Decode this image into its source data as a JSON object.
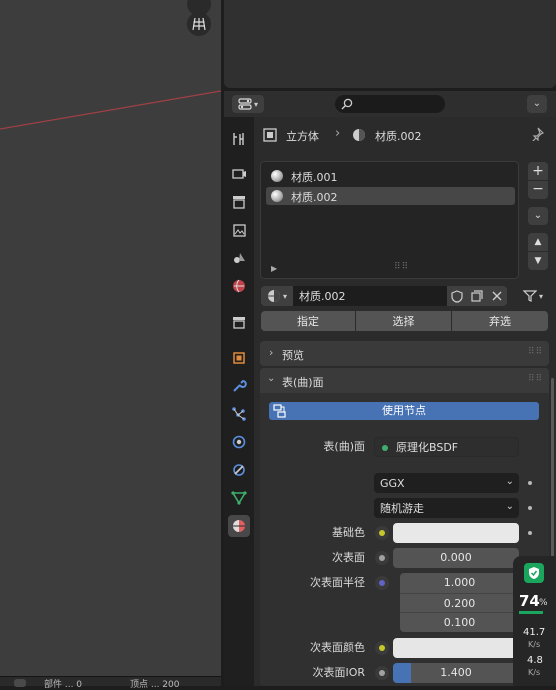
{
  "header": {
    "search_placeholder": ""
  },
  "breadcrumb": {
    "object": "立方体",
    "material": "材质.002"
  },
  "material_slots": [
    {
      "label": "材质.001",
      "selected": false
    },
    {
      "label": "材质.002",
      "selected": true
    }
  ],
  "datablock": {
    "name": "材质.002"
  },
  "slot_buttons": {
    "assign": "指定",
    "select": "选择",
    "deselect": "弃选"
  },
  "panels": {
    "preview": "预览",
    "surface": "表(曲)面"
  },
  "use_nodes": "使用节点",
  "surface": {
    "surface_label": "表(曲)面",
    "shader": "原理化BSDF",
    "distribution": "GGX",
    "subsurface_method": "随机游走",
    "base_color_label": "基础色",
    "subsurface_label": "次表面",
    "subsurface_value": "0.000",
    "subsurface_radius_label": "次表面半径",
    "subsurface_radius": [
      "1.000",
      "0.200",
      "0.100"
    ],
    "subsurface_color_label": "次表面颜色",
    "subsurface_ior_label": "次表面IOR",
    "subsurface_ior_value": "1.400",
    "subsurface_ior_fill": 0.14
  },
  "overlay": {
    "percent": "74",
    "percent_unit": "%",
    "up_speed": "41.7",
    "up_unit": "K/s",
    "down_speed": "4.8",
    "down_unit": "K/s"
  },
  "footer": {
    "left_text": "部件 ... 0",
    "right_text": "顶点 ... 200"
  },
  "colors": {
    "accent_blue": "#4772b3",
    "base_color": "#e8e8e8",
    "active_tab": "#484848",
    "material_red": "#e06060",
    "green_badge": "#1aa65c"
  },
  "icons": [
    "overlay-icon",
    "grid-icon",
    "editor-type-icon",
    "search-icon",
    "object-icon",
    "material-icon",
    "pin-icon",
    "add-icon",
    "remove-icon",
    "move-up-icon",
    "move-down-icon",
    "shield-icon",
    "copy-icon",
    "close-icon",
    "filter-icon"
  ]
}
